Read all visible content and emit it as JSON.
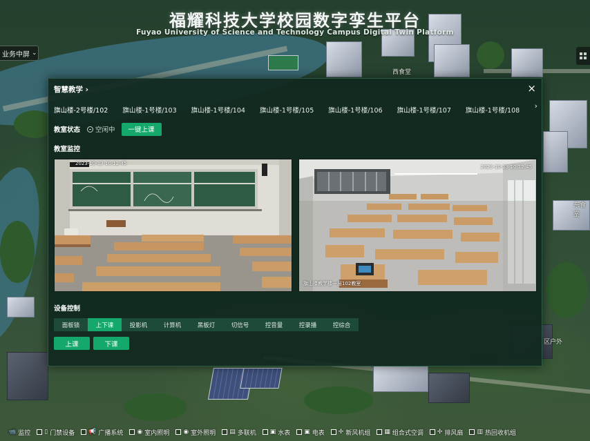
{
  "header": {
    "title_cn": "福耀科技大学校园数字孪生平台",
    "title_en": "Fuyao University of Science and Technology Campus Digital Twin Platform"
  },
  "left_dropdown": {
    "label": "业务中屏"
  },
  "map_labels": {
    "west_canteen": "西食堂",
    "east_canteen": "东食堂",
    "outdoor": "区户外"
  },
  "panel": {
    "breadcrumb": "智慧教学",
    "tabs": [
      {
        "label": "旗山楼-2号楼/102",
        "active": true
      },
      {
        "label": "旗山楼-1号楼/103",
        "active": false
      },
      {
        "label": "旗山楼-1号楼/104",
        "active": false
      },
      {
        "label": "旗山楼-1号楼/105",
        "active": false
      },
      {
        "label": "旗山楼-1号楼/106",
        "active": false
      },
      {
        "label": "旗山楼-1号楼/107",
        "active": false
      },
      {
        "label": "旗山楼-1号楼/108",
        "active": false
      }
    ],
    "status_label": "教室状态",
    "status_value": "空闲中",
    "one_key_button": "一键上课",
    "monitor_title": "教室监控",
    "cameras": [
      {
        "timestamp": "2023-10-13 10:12:45"
      },
      {
        "timestamp": "2023-10-13 10:12:45",
        "caption": "旗山楼教学楼一层102教室"
      }
    ],
    "device_title": "设备控制",
    "device_tabs": [
      {
        "label": "面板锁",
        "active": false
      },
      {
        "label": "上下课",
        "active": true
      },
      {
        "label": "投影机",
        "active": false
      },
      {
        "label": "计算机",
        "active": false
      },
      {
        "label": "黑板灯",
        "active": false
      },
      {
        "label": "切信号",
        "active": false
      },
      {
        "label": "控音量",
        "active": false
      },
      {
        "label": "控录播",
        "active": false
      },
      {
        "label": "控综合",
        "active": false
      }
    ],
    "actions": {
      "up": "上课",
      "down": "下课"
    }
  },
  "legend": [
    {
      "label": "监控",
      "icon": "camera-icon"
    },
    {
      "label": "门禁设备",
      "icon": "door-icon"
    },
    {
      "label": "广播系统",
      "icon": "speaker-icon"
    },
    {
      "label": "室内照明",
      "icon": "pin-icon"
    },
    {
      "label": "室外照明",
      "icon": "pin-icon"
    },
    {
      "label": "多联机",
      "icon": "server-icon"
    },
    {
      "label": "水表",
      "icon": "meter-icon"
    },
    {
      "label": "电表",
      "icon": "meter-icon"
    },
    {
      "label": "新风机组",
      "icon": "fan-icon"
    },
    {
      "label": "组合式空调",
      "icon": "ac-icon"
    },
    {
      "label": "排风扇",
      "icon": "fan-icon"
    },
    {
      "label": "热回收机组",
      "icon": "recovery-icon"
    }
  ],
  "colors": {
    "accent": "#14a86a",
    "panel_bg": "#10281e",
    "tab_inactive": "#1e4a39"
  }
}
